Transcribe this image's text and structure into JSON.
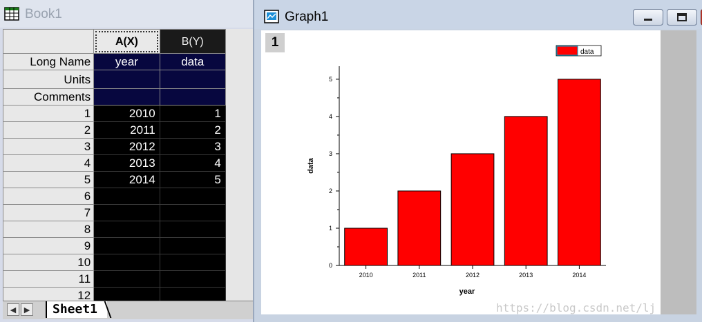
{
  "book": {
    "title": "Book1",
    "columns": [
      {
        "header": "A(X)",
        "long_name": "year",
        "units": "",
        "comments": ""
      },
      {
        "header": "B(Y)",
        "long_name": "data",
        "units": "",
        "comments": ""
      }
    ],
    "row_labels": {
      "long_name": "Long Name",
      "units": "Units",
      "comments": "Comments"
    },
    "rows": [
      {
        "n": "1",
        "a": "2010",
        "b": "1"
      },
      {
        "n": "2",
        "a": "2011",
        "b": "2"
      },
      {
        "n": "3",
        "a": "2012",
        "b": "3"
      },
      {
        "n": "4",
        "a": "2013",
        "b": "4"
      },
      {
        "n": "5",
        "a": "2014",
        "b": "5"
      },
      {
        "n": "6",
        "a": "",
        "b": ""
      },
      {
        "n": "7",
        "a": "",
        "b": ""
      },
      {
        "n": "8",
        "a": "",
        "b": ""
      },
      {
        "n": "9",
        "a": "",
        "b": ""
      },
      {
        "n": "10",
        "a": "",
        "b": ""
      },
      {
        "n": "11",
        "a": "",
        "b": ""
      },
      {
        "n": "12",
        "a": "",
        "b": ""
      }
    ],
    "sheet_tab": "Sheet1",
    "nav": {
      "prev": "◀",
      "next": "▶"
    }
  },
  "graph": {
    "title": "Graph1",
    "layer": "1"
  },
  "watermark": "https://blog.csdn.net/lj",
  "colors": {
    "bar": "#ff0000",
    "meta_bg": "#07073f"
  },
  "chart_data": {
    "type": "bar",
    "categories": [
      "2010",
      "2011",
      "2012",
      "2013",
      "2014"
    ],
    "series": [
      {
        "name": "data",
        "values": [
          1,
          2,
          3,
          4,
          5
        ]
      }
    ],
    "xlabel": "year",
    "ylabel": "data",
    "ylim": [
      0,
      5.35
    ],
    "yticks": [
      "0",
      "1",
      "2",
      "3",
      "4",
      "5"
    ],
    "grid": false,
    "legend": "top-right"
  }
}
